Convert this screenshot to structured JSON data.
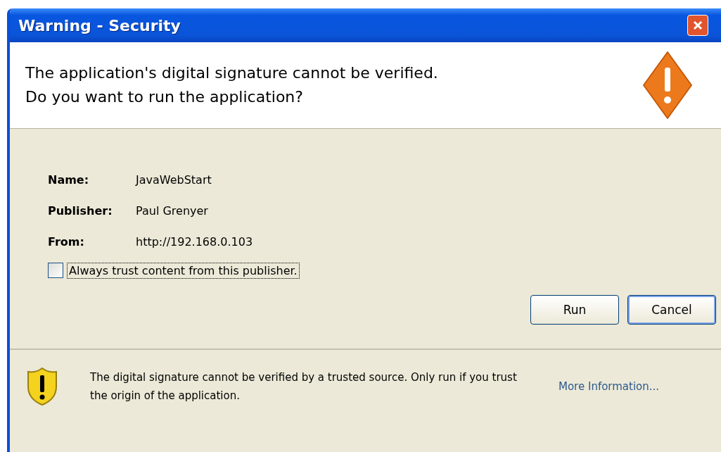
{
  "window": {
    "title": "Warning - Security"
  },
  "header": {
    "message": "The application's digital signature cannot be verified.\nDo you want to run the application?"
  },
  "details": [
    {
      "label": "Name:",
      "value": "JavaWebStart"
    },
    {
      "label": "Publisher:",
      "value": "Paul Grenyer"
    },
    {
      "label": "From:",
      "value": "http://192.168.0.103"
    }
  ],
  "trust_checkbox": {
    "label": "Always trust content from this publisher.",
    "checked": false
  },
  "buttons": [
    {
      "label": "Run",
      "selected": false
    },
    {
      "label": "Cancel",
      "selected": true
    }
  ],
  "footer": {
    "text": "The digital signature cannot be verified by a trusted source.  Only run if you trust the origin of the application.",
    "link": "More Information..."
  }
}
